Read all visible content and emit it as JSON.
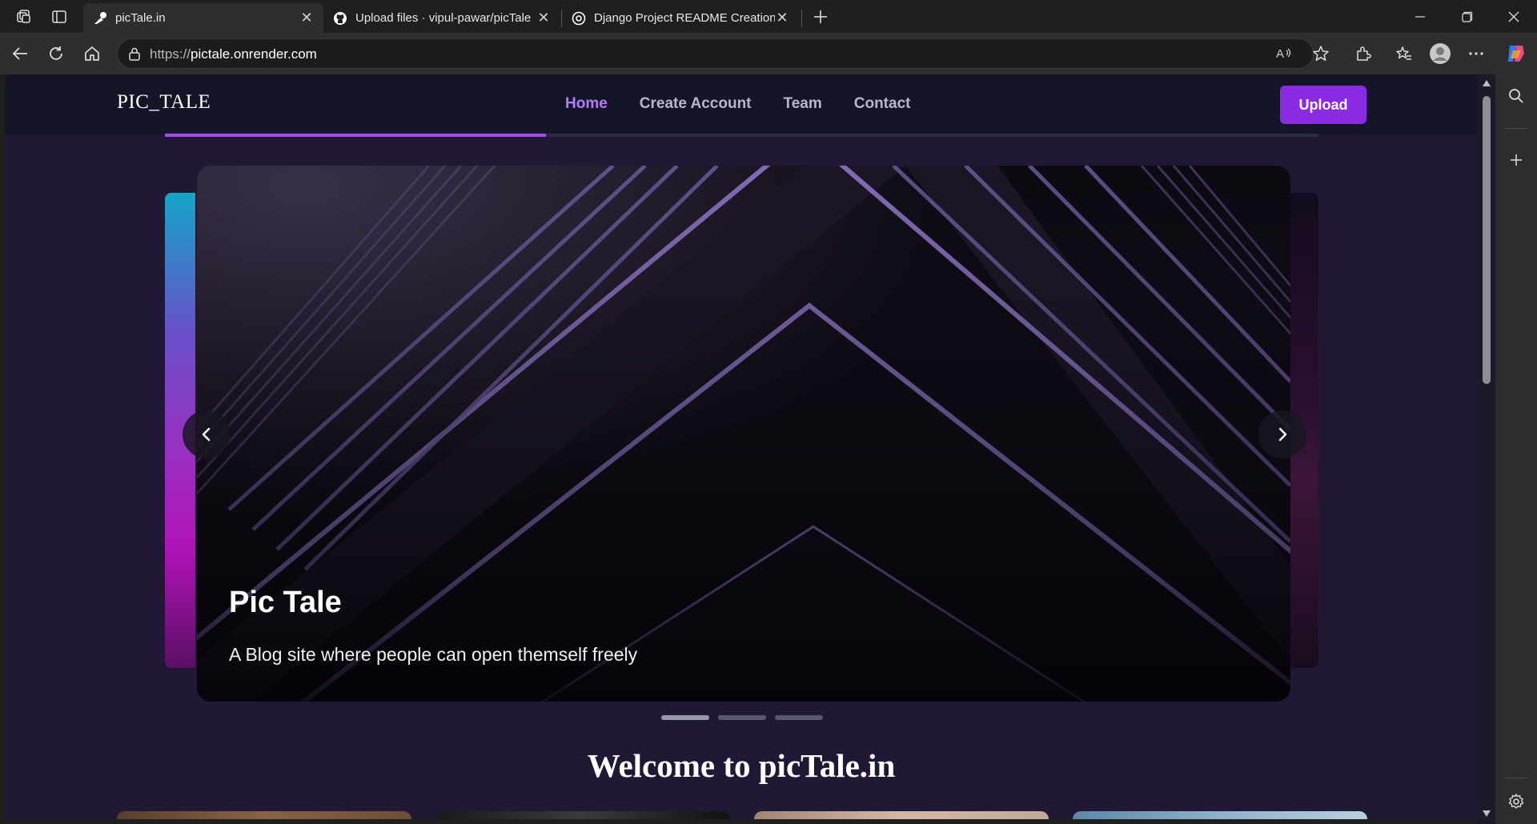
{
  "browser": {
    "tabs": [
      {
        "title": "picTale.in",
        "active": true
      },
      {
        "title": "Upload files · vipul-pawar/picTale",
        "active": false
      },
      {
        "title": "Django Project README Creation",
        "active": false
      }
    ],
    "url": {
      "scheme": "https://",
      "host": "pictale.onrender.com"
    }
  },
  "site": {
    "logo": "PIC_TALE",
    "nav": {
      "items": [
        {
          "label": "Home",
          "active": true
        },
        {
          "label": "Create Account",
          "active": false
        },
        {
          "label": "Team",
          "active": false
        },
        {
          "label": "Contact",
          "active": false
        }
      ],
      "upload_label": "Upload"
    },
    "carousel": {
      "progress": 0.33,
      "slide_title": "Pic Tale",
      "slide_subtitle": "A Blog site where people can open themself freely",
      "slide_count": 3,
      "active_index": 0
    },
    "welcome": "Welcome to picTale.in"
  },
  "colors": {
    "accent": "#8a2be2",
    "nav_active": "#b57cf5",
    "page_bg": "#211836",
    "nav_bg": "#141628"
  }
}
